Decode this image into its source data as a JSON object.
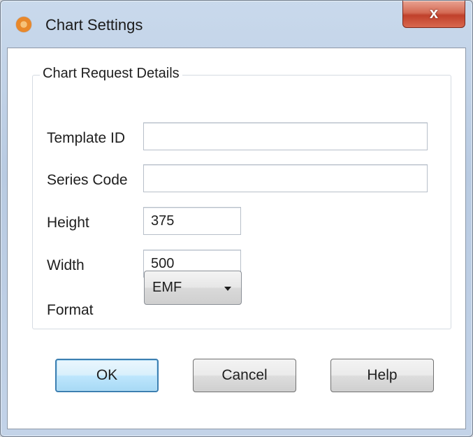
{
  "window": {
    "title": "Chart Settings",
    "close_label": "x"
  },
  "group": {
    "title": "Chart Request Details"
  },
  "fields": {
    "template_id": {
      "label": "Template ID",
      "value": ""
    },
    "series_code": {
      "label": "Series Code",
      "value": ""
    },
    "height": {
      "label": "Height",
      "value": "375"
    },
    "width": {
      "label": "Width",
      "value": "500"
    },
    "format": {
      "label": "Format",
      "value": "EMF"
    }
  },
  "buttons": {
    "ok": "OK",
    "cancel": "Cancel",
    "help": "Help"
  },
  "icons": {
    "app": "chart-app-icon",
    "close": "close-icon",
    "dropdown": "chevron-down-icon"
  },
  "colors": {
    "title_bar": "#c9d9ec",
    "close_button": "#c0402b",
    "default_button_border": "#3c7fb1",
    "client_background": "#ffffff"
  }
}
